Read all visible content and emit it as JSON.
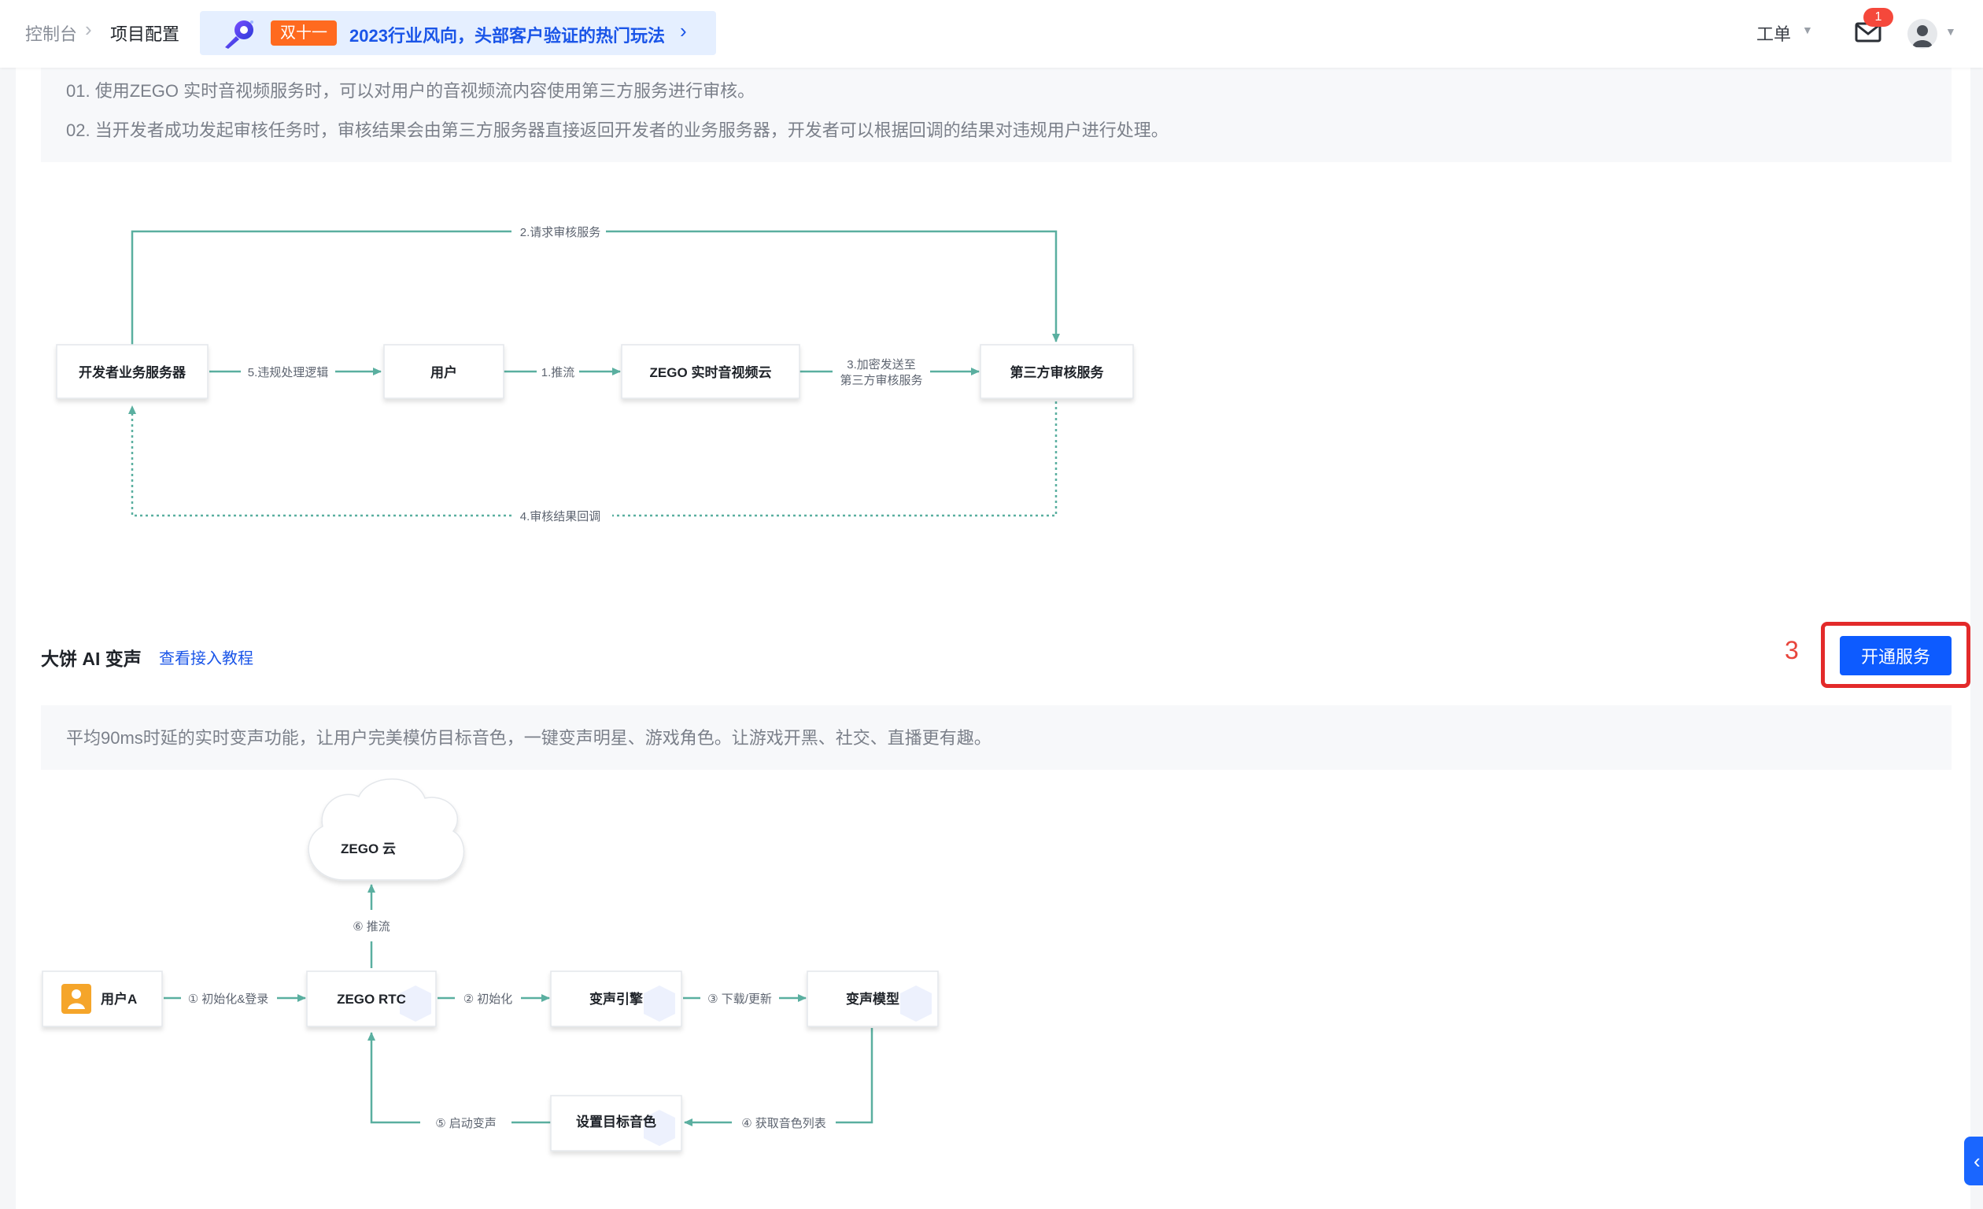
{
  "header": {
    "breadcrumb": [
      "控制台",
      "项目配置"
    ],
    "breadcrumb_sep": "›",
    "promo": {
      "tag": "双十一",
      "text": "2023行业风向，头部客户验证的热门玩法",
      "arrow": "›"
    },
    "ticket_label": "工单",
    "mail_badge": "1"
  },
  "moderation": {
    "desc": [
      "01. 使用ZEGO 实时音视频服务时，可以对用户的音视频流内容使用第三方服务进行审核。",
      "02. 当开发者成功发起审核任务时，审核结果会由第三方服务器直接返回开发者的业务服务器，开发者可以根据回调的结果对违规用户进行处理。"
    ],
    "diagram": {
      "nodes": [
        "开发者业务服务器",
        "用户",
        "ZEGO 实时音视频云",
        "第三方审核服务"
      ],
      "edges": {
        "request": "2.请求审核服务",
        "violation": "5.违规处理逻辑",
        "push": "1.推流",
        "encrypt_1": "3.加密发送至",
        "encrypt_2": "第三方审核服务",
        "callback": "4.审核结果回调"
      }
    }
  },
  "voice_change": {
    "title": "大饼 AI 变声",
    "tutorial_link": "查看接入教程",
    "step_number": "3",
    "open_button": "开通服务",
    "desc": "平均90ms时延的实时变声功能，让用户完美模仿目标音色，一键变声明星、游戏角色。让游戏开黑、社交、直播更有趣。",
    "diagram": {
      "cloud": "ZEGO 云",
      "nodes": [
        "用户A",
        "ZEGO RTC",
        "变声引擎",
        "变声模型",
        "设置目标音色"
      ],
      "edges": {
        "push": "⑥ 推流",
        "init_login": "① 初始化&登录",
        "init": "② 初始化",
        "download": "③ 下载/更新",
        "get_list": "④ 获取音色列表",
        "start": "⑤ 启动变声"
      }
    }
  },
  "colors": {
    "accent": "#0d5bff",
    "flow_line": "#5aafa0",
    "highlight": "#e32a2a"
  }
}
